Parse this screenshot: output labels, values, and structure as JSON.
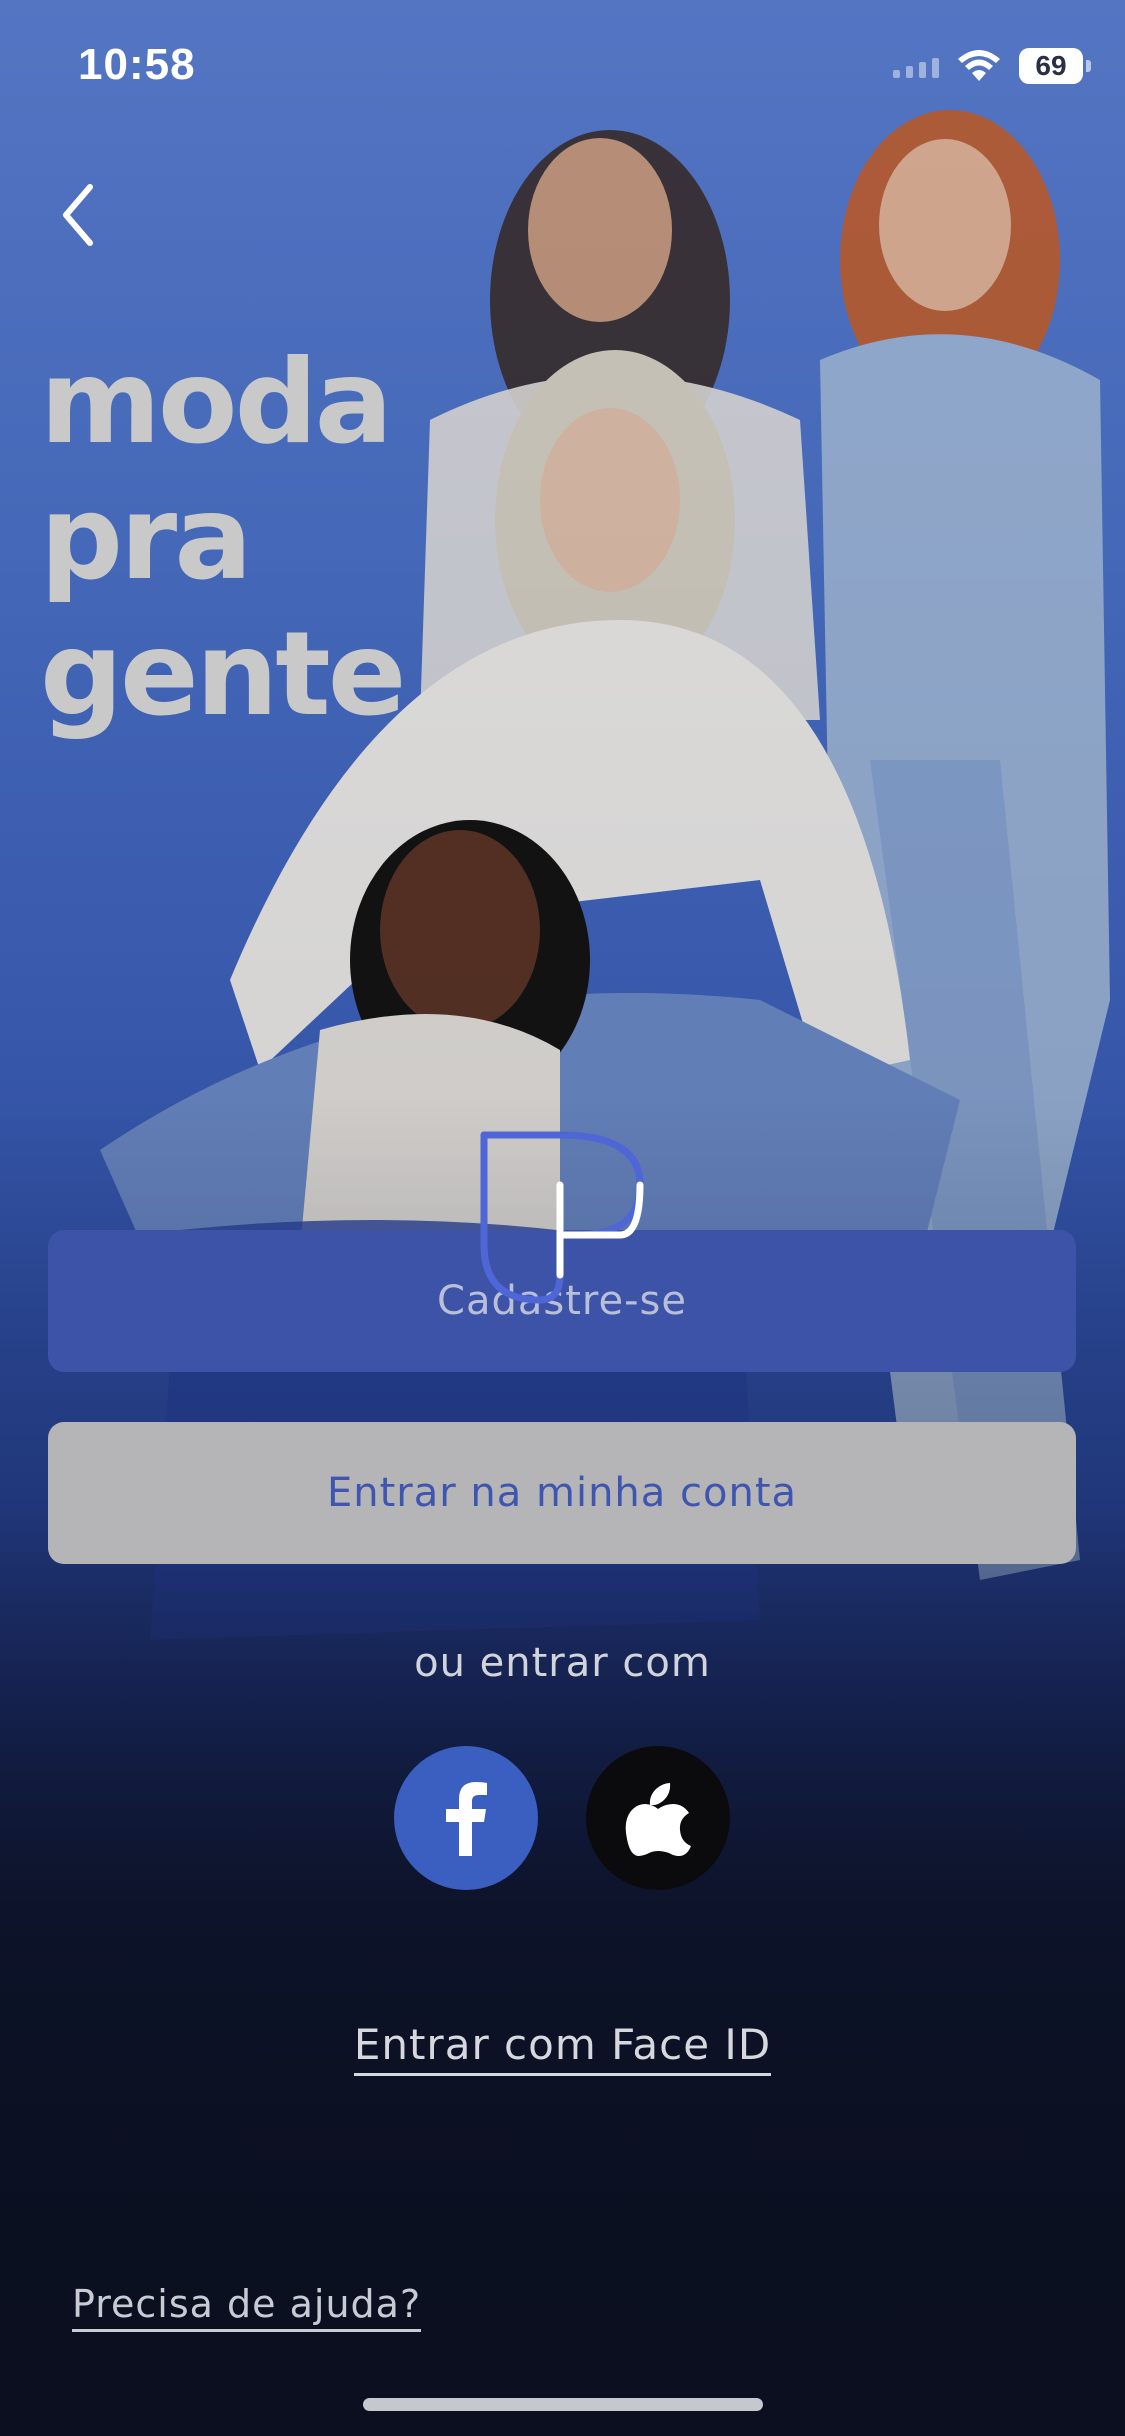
{
  "status_bar": {
    "time": "10:58",
    "battery": "69"
  },
  "hero": {
    "slogan_lines": [
      "moda",
      "pra",
      "gente"
    ]
  },
  "actions": {
    "signup_label": "Cadastre-se",
    "login_label": "Entrar na minha conta",
    "or_label": "ou entrar com"
  },
  "social": {
    "facebook_icon": "facebook-icon",
    "apple_icon": "apple-icon"
  },
  "links": {
    "faceid_label": "Entrar com Face ID",
    "help_label": "Precisa de ajuda?"
  },
  "colors": {
    "primary_blue": "#3d53a8",
    "login_button_bg": "#b5b5b7",
    "facebook_blue": "#3b5fc0"
  }
}
